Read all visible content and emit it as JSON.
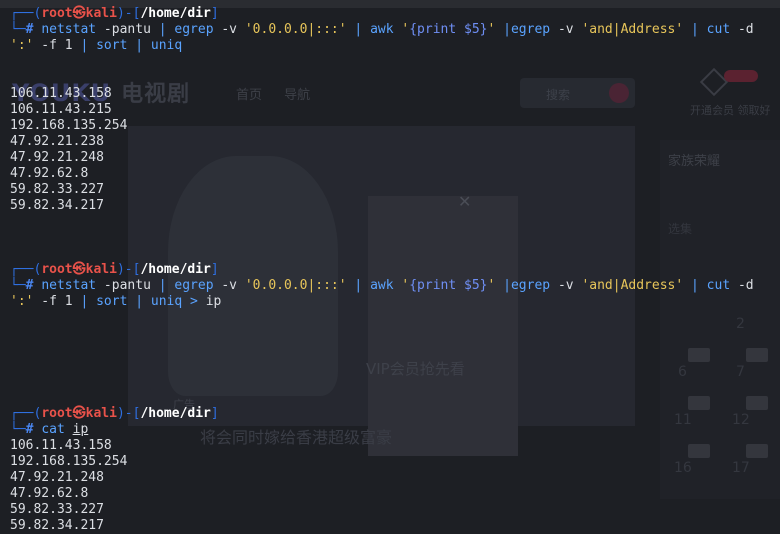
{
  "background_page": {
    "logo": "YOUKU",
    "logo_section": "电视剧",
    "nav_items": [
      "首页",
      "导航"
    ],
    "search_placeholder": "搜索",
    "vip_text": "开通会员 领取好",
    "panel_title": "家族荣耀",
    "panel_sub": "选集",
    "video_overlay_text": "VIP会员抢先看",
    "bottom_ad": "将会同时嫁给香港超级富豪",
    "ad_tag": "广告",
    "episodes": [
      "2",
      "6",
      "7",
      "11",
      "12",
      "16",
      "17"
    ]
  },
  "terminal": {
    "prompt": {
      "user": "root",
      "at": "㉿",
      "host": "kali",
      "path": "/home/dir"
    },
    "blocks": [
      {
        "command_parts": [
          {
            "t": "netstat",
            "c": "cmd"
          },
          {
            "t": " -pantu ",
            "c": "dflt"
          },
          {
            "t": "|",
            "c": "pipe"
          },
          {
            "t": " egrep",
            "c": "cmd"
          },
          {
            "t": " -v ",
            "c": "dflt"
          },
          {
            "t": "'0.0.0.0|:::'",
            "c": "str"
          },
          {
            "t": " | ",
            "c": "pipe"
          },
          {
            "t": "awk",
            "c": "cmd"
          },
          {
            "t": " '",
            "c": "str"
          },
          {
            "t": "{print $5}",
            "c": "brace"
          },
          {
            "t": "' ",
            "c": "str"
          },
          {
            "t": "|egrep",
            "c": "cmd"
          },
          {
            "t": " -v ",
            "c": "dflt"
          },
          {
            "t": "'and|Address'",
            "c": "str"
          },
          {
            "t": " | ",
            "c": "pipe"
          },
          {
            "t": "cut",
            "c": "cmd"
          },
          {
            "t": " -d",
            "c": "dflt"
          }
        ],
        "command_wrap_parts": [
          {
            "t": "':'",
            "c": "str"
          },
          {
            "t": " -f 1 ",
            "c": "dflt"
          },
          {
            "t": "|",
            "c": "pipe"
          },
          {
            "t": " sort",
            "c": "cmd"
          },
          {
            "t": " | ",
            "c": "pipe"
          },
          {
            "t": "uniq",
            "c": "cmd"
          }
        ],
        "output": [
          "106.11.43.158",
          "106.11.43.215",
          "192.168.135.254",
          "47.92.21.238",
          "47.92.21.248",
          "47.92.62.8",
          "59.82.33.227",
          "59.82.34.217"
        ]
      },
      {
        "command_parts": [
          {
            "t": "netstat",
            "c": "cmd"
          },
          {
            "t": " -pantu ",
            "c": "dflt"
          },
          {
            "t": "|",
            "c": "pipe"
          },
          {
            "t": " egrep",
            "c": "cmd"
          },
          {
            "t": " -v ",
            "c": "dflt"
          },
          {
            "t": "'0.0.0.0|:::'",
            "c": "str"
          },
          {
            "t": " | ",
            "c": "pipe"
          },
          {
            "t": "awk",
            "c": "cmd"
          },
          {
            "t": " '",
            "c": "str"
          },
          {
            "t": "{print $5}",
            "c": "brace"
          },
          {
            "t": "' ",
            "c": "str"
          },
          {
            "t": "|egrep",
            "c": "cmd"
          },
          {
            "t": " -v ",
            "c": "dflt"
          },
          {
            "t": "'and|Address'",
            "c": "str"
          },
          {
            "t": " | ",
            "c": "pipe"
          },
          {
            "t": "cut",
            "c": "cmd"
          },
          {
            "t": " -d",
            "c": "dflt"
          }
        ],
        "command_wrap_parts": [
          {
            "t": "':'",
            "c": "str"
          },
          {
            "t": " -f 1 ",
            "c": "dflt"
          },
          {
            "t": "|",
            "c": "pipe"
          },
          {
            "t": " sort",
            "c": "cmd"
          },
          {
            "t": " | ",
            "c": "pipe"
          },
          {
            "t": "uniq",
            "c": "cmd"
          },
          {
            "t": " > ",
            "c": "pipe"
          },
          {
            "t": "ip",
            "c": "dflt"
          }
        ],
        "output": []
      },
      {
        "command_parts": [
          {
            "t": "cat",
            "c": "cmd"
          },
          {
            "t": " ",
            "c": "dflt"
          },
          {
            "t": "ip",
            "c": "dflt ul"
          }
        ],
        "command_wrap_parts": [],
        "output": [
          "106.11.43.158",
          "192.168.135.254",
          "47.92.21.248",
          "47.92.62.8",
          "59.82.33.227",
          "59.82.34.217"
        ]
      }
    ]
  }
}
